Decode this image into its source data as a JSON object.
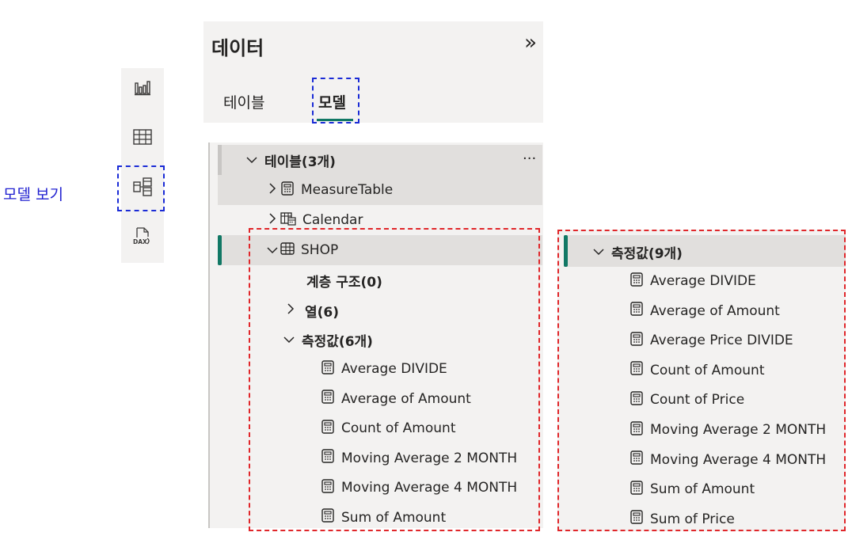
{
  "annotation": {
    "model_view_label": "모델 보기"
  },
  "view_switcher": {
    "items": [
      {
        "name": "report-view",
        "icon": "bar-chart-icon"
      },
      {
        "name": "table-view",
        "icon": "table-grid-icon"
      },
      {
        "name": "model-view",
        "icon": "model-diagram-icon"
      },
      {
        "name": "dax-query-view",
        "icon": "dax-doc-icon",
        "icon_text": "DAX"
      }
    ]
  },
  "data_pane": {
    "title": "데이터",
    "collapse_glyph": "»",
    "tabs": [
      {
        "label": "테이블"
      },
      {
        "label": "모델"
      }
    ],
    "active_tab": "모델",
    "accent_color": "#117865"
  },
  "tree": {
    "tables_header": "테이블(3개)",
    "more_glyph": "···",
    "tables": [
      {
        "name": "MeasureTable",
        "icon": "measure-table-icon"
      },
      {
        "name": "Calendar",
        "icon": "calendar-table-icon"
      },
      {
        "name": "SHOP",
        "icon": "table-icon"
      }
    ],
    "shop_children": {
      "hierarchy": "계층 구조(0)",
      "columns": "열(6)",
      "measures_header": "측정값(6개)",
      "measures": [
        "Average DIVIDE",
        "Average of Amount",
        "Count of Amount",
        "Moving Average 2 MONTH",
        "Moving Average 4 MONTH",
        "Sum of Amount"
      ]
    }
  },
  "right_panel": {
    "measures_header": "측정값(9개)",
    "measures": [
      "Average DIVIDE",
      "Average of Amount",
      "Average Price DIVIDE",
      "Count of Amount",
      "Count of Price",
      "Moving Average 2 MONTH",
      "Moving Average 4 MONTH",
      "Sum of Amount",
      "Sum of Price"
    ]
  }
}
